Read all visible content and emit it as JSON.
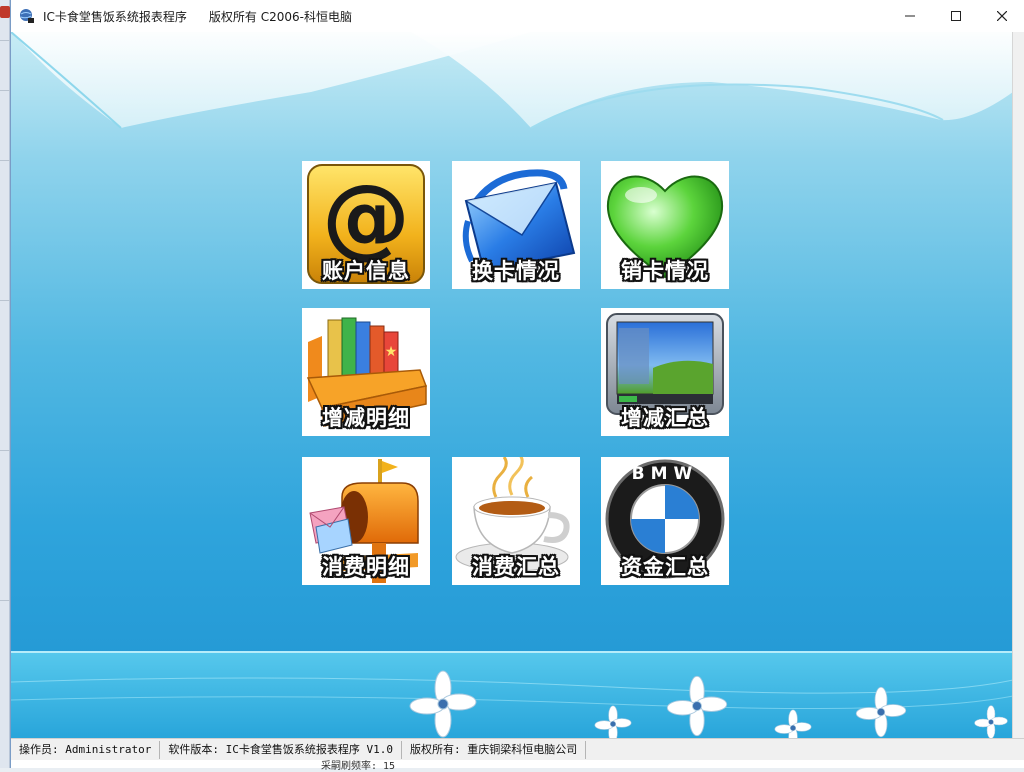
{
  "window": {
    "title": "IC卡食堂售饭系统报表程序",
    "copyright": "版权所有 C2006-科恒电脑"
  },
  "tiles": [
    {
      "label": "账户信息",
      "icon": "at-sign-icon"
    },
    {
      "label": "换卡情况",
      "icon": "envelope-icon"
    },
    {
      "label": "销卡情况",
      "icon": "heart-icon"
    },
    {
      "label": "增减明细",
      "icon": "books-icon"
    },
    {
      "label": "增减汇总",
      "icon": "monitor-icon"
    },
    {
      "label": "消费明细",
      "icon": "mailbox-icon"
    },
    {
      "label": "消费汇总",
      "icon": "coffee-cup-icon"
    },
    {
      "label": "资金汇总",
      "icon": "bmw-logo-icon"
    }
  ],
  "bmw_logo_text": "BMW",
  "statusbar": {
    "operator": "操作员: Administrator",
    "version": "软件版本: IC卡食堂售饭系统报表程序 V1.0",
    "copyright": "版权所有: 重庆铜梁科恒电脑公司"
  },
  "underlying_text": "采嗣刷频率: 15",
  "colors": {
    "sky_top": "#c8ecf5",
    "sky_bottom": "#1e94d2",
    "label_outline": "#111111"
  }
}
